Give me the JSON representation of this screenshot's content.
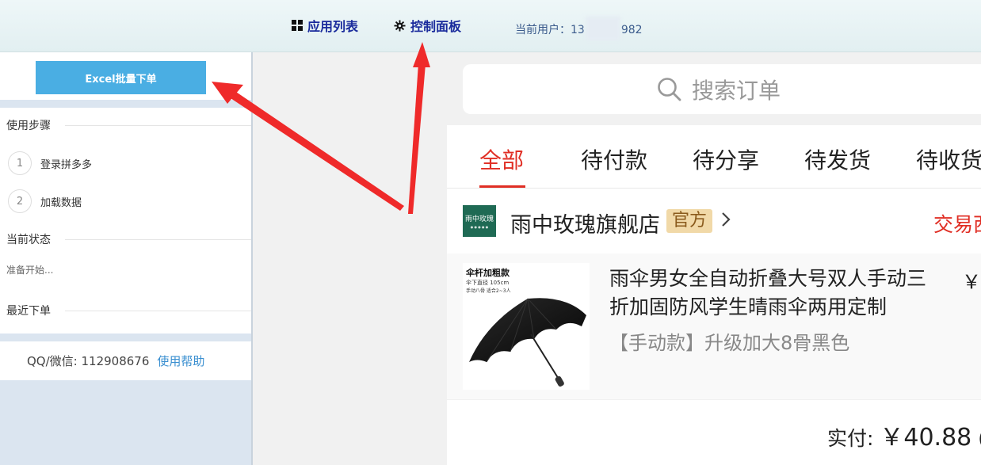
{
  "topbar": {
    "apps_label": "应用列表",
    "panel_label": "控制面板",
    "current_user_prefix": "当前用户：13",
    "current_user_suffix": "982"
  },
  "left_panel": {
    "excel_button": "Excel批量下单",
    "steps_title": "使用步骤",
    "steps": [
      {
        "num": "1",
        "label": "登录拼多多"
      },
      {
        "num": "2",
        "label": "加载数据"
      }
    ],
    "status_title": "当前状态",
    "status_text": "准备开始...",
    "recent_title": "最近下单",
    "contact": "QQ/微信: 112908676",
    "help_link": "使用帮助"
  },
  "app": {
    "search_placeholder": "搜索订单",
    "tabs": [
      "全部",
      "待付款",
      "待分享",
      "待发货",
      "待收货"
    ],
    "active_tab": 0,
    "shop": {
      "name": "雨中玫瑰旗舰店",
      "badge": "官方",
      "status": "交易西",
      "logo_text": "雨中玫瑰"
    },
    "item": {
      "image_title": "伞杆加粗款",
      "image_sub1": "伞下直径 105cm",
      "image_sub2": "手动八骨  适合2~3人",
      "title": "雨伞男女全自动折叠大号双人手动三折加固防风学生晴雨伞两用定制",
      "sku": "【手动款】升级加大8骨黑色",
      "price_symbol": "￥"
    },
    "total": {
      "label": "实付: ",
      "amount": "￥40.88",
      "rest": " (免"
    }
  },
  "colors": {
    "accent_red": "#e02e24",
    "excel_button": "#4aaee3",
    "nav_text": "#1a2b9c",
    "annotation_arrow": "#ef2a2a"
  }
}
